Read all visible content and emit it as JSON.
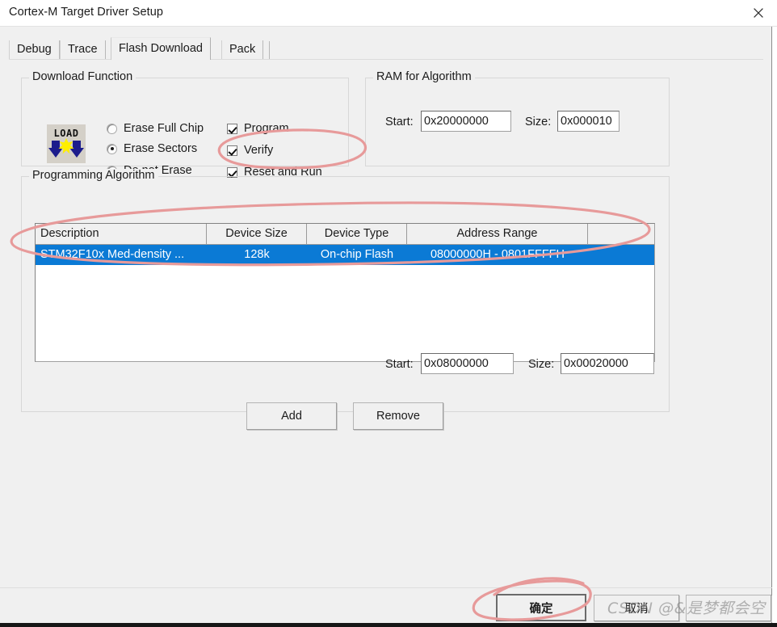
{
  "window": {
    "title": "Cortex-M Target Driver Setup",
    "close_icon": "close-icon"
  },
  "tabs": [
    {
      "label": "Debug",
      "active": false
    },
    {
      "label": "Trace",
      "active": false
    },
    {
      "label": "Flash Download",
      "active": true
    },
    {
      "label": "Pack",
      "active": false
    }
  ],
  "download_function": {
    "title": "Download Function",
    "icon": "load-flash-icon",
    "icon_text": "LOAD",
    "erase_options": [
      {
        "label": "Erase Full Chip",
        "selected": false
      },
      {
        "label": "Erase Sectors",
        "selected": true
      },
      {
        "label": "Do not Erase",
        "selected": false
      }
    ],
    "checkboxes": [
      {
        "label": "Program",
        "checked": true
      },
      {
        "label": "Verify",
        "checked": true
      },
      {
        "label": "Reset and Run",
        "checked": true
      }
    ]
  },
  "ram_for_algorithm": {
    "title": "RAM for Algorithm",
    "start_label": "Start:",
    "start_value": "0x20000000",
    "size_label": "Size:",
    "size_value": "0x000010"
  },
  "programming_algorithm": {
    "title": "Programming Algorithm",
    "columns": [
      "Description",
      "Device Size",
      "Device Type",
      "Address Range",
      ""
    ],
    "rows": [
      {
        "description": "STM32F10x Med-density ...",
        "device_size": "128k",
        "device_type": "On-chip Flash",
        "address_range": "08000000H - 0801FFFFH",
        "selected": true
      }
    ],
    "start_label": "Start:",
    "start_value": "0x08000000",
    "size_label": "Size:",
    "size_value": "0x00020000",
    "add_button": "Add",
    "remove_button": "Remove"
  },
  "footer": {
    "ok_button": "确定",
    "cancel_button": "取消",
    "help_button": ""
  },
  "watermark": {
    "text": "CSDN @&是梦都会空"
  },
  "colors": {
    "dialog_bg": "#f0f0f0",
    "selection_blue": "#0b7ad5",
    "annotation_red": "#e08b8b",
    "icon_navy": "#1c1c8c",
    "icon_yellow": "#ffee00"
  }
}
